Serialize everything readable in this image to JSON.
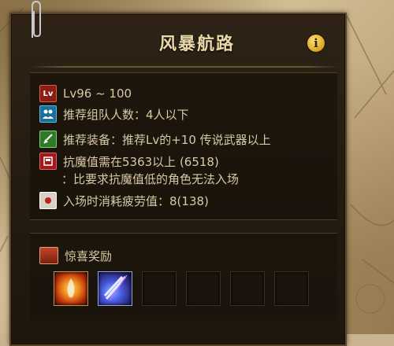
{
  "panel": {
    "title": "风暴航路",
    "info_icon_label": "i"
  },
  "info": {
    "level_icon": "Lv",
    "level_text": "Lv96 ~ 100",
    "party_text": "推荐组队人数：4人以下",
    "equip_text": "推荐装备：推荐Lv的+10 传说武器以上",
    "resist_text": "抗魔值需在5363以上 (6518)",
    "resist_sub_text": "：比要求抗魔值低的角色无法入场",
    "fatigue_text": "入场时消耗疲劳值：8(138)"
  },
  "rewards": {
    "title": "惊喜奖励",
    "slots": [
      "orb-item",
      "crystal-blade-item",
      "",
      "",
      "",
      ""
    ]
  },
  "colors": {
    "panel_bg": "#231a10",
    "text": "#d8c9a6",
    "title": "#e9d9a8",
    "info_button": "#d9a320"
  }
}
